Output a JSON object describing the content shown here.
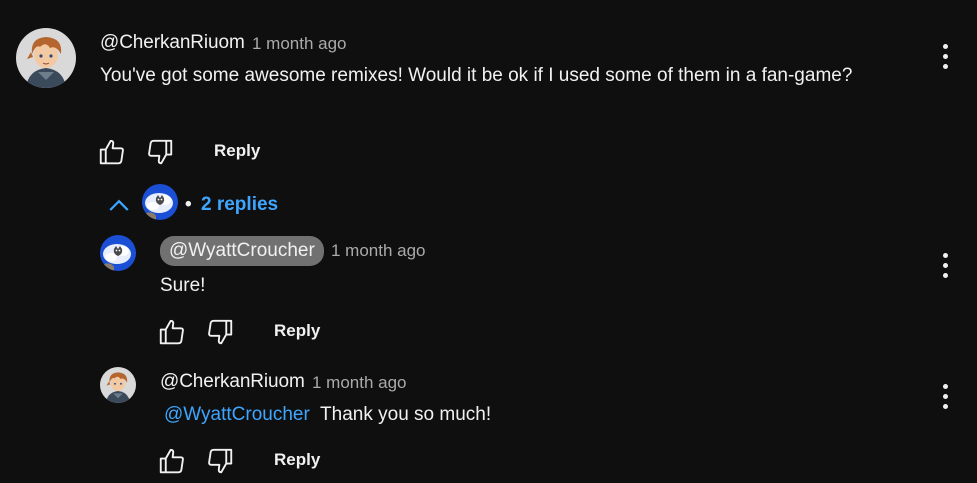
{
  "colors": {
    "background": "#0f0f0f",
    "text": "#f1f1f1",
    "muted": "#aaaaaa",
    "link": "#3ea6ff",
    "chip": "#717171"
  },
  "top_comment": {
    "author": "@CherkanRiuom",
    "time": "1 month ago",
    "text": "You've got some awesome remixes! Would it be ok if I used some of them in a fan-game?",
    "reply_label": "Reply",
    "avatar_icon": "anime-character-avatar"
  },
  "replies_toggle": {
    "chevron_icon": "chevron-up-icon",
    "bullet": "•",
    "label": "2 replies"
  },
  "replies": [
    {
      "author": "@WyattCroucher",
      "time": "1 month ago",
      "text": "Sure!",
      "reply_label": "Reply",
      "avatar_icon": "cat-avatar"
    },
    {
      "author": "@CherkanRiuom",
      "time": "1 month ago",
      "mention": "@WyattCroucher",
      "text": "Thank you so much!",
      "reply_label": "Reply",
      "avatar_icon": "anime-character-avatar"
    }
  ]
}
